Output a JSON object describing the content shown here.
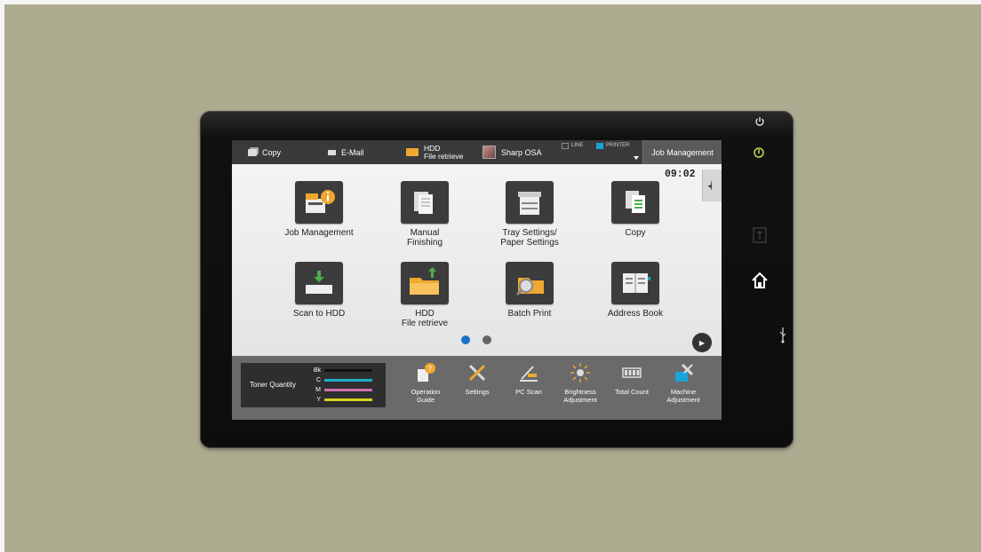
{
  "topbar": {
    "copy": "Copy",
    "email": "E-Mail",
    "hdd_line1": "HDD",
    "hdd_line2": "File retrieve",
    "osa": "Sharp OSA",
    "line_indicator": "LINE",
    "printer_indicator": "PRINTER",
    "job_management": "Job Management"
  },
  "clock": "09:02",
  "tiles": [
    {
      "line1": "Job Management",
      "line2": ""
    },
    {
      "line1": "Manual",
      "line2": "Finishing"
    },
    {
      "line1": "Tray Settings/",
      "line2": "Paper Settings"
    },
    {
      "line1": "Copy",
      "line2": ""
    },
    {
      "line1": "Scan to HDD",
      "line2": ""
    },
    {
      "line1": "HDD",
      "line2": "File retrieve"
    },
    {
      "line1": "Batch Print",
      "line2": ""
    },
    {
      "line1": "Address Book",
      "line2": ""
    }
  ],
  "toner": {
    "title": "Toner Quantity",
    "rows": [
      {
        "label": "Bk",
        "color": "#111111"
      },
      {
        "label": "C",
        "color": "#1ab0c8"
      },
      {
        "label": "M",
        "color": "#d070b0"
      },
      {
        "label": "Y",
        "color": "#d8d020"
      }
    ]
  },
  "bottom": [
    {
      "line1": "Operation",
      "line2": "Guide",
      "icon": "operation-guide-icon"
    },
    {
      "line1": "Settings",
      "line2": "",
      "icon": "settings-icon"
    },
    {
      "line1": "PC Scan",
      "line2": "",
      "icon": "pc-scan-icon"
    },
    {
      "line1": "Brightness",
      "line2": "Adjustment",
      "icon": "brightness-icon"
    },
    {
      "line1": "Total Count",
      "line2": "",
      "icon": "total-count-icon"
    },
    {
      "line1": "Machine",
      "line2": "Adjustment",
      "icon": "machine-adjustment-icon"
    }
  ],
  "colors": {
    "page_indicator_active": "#1a73c8",
    "home_button": "#ffffff"
  }
}
